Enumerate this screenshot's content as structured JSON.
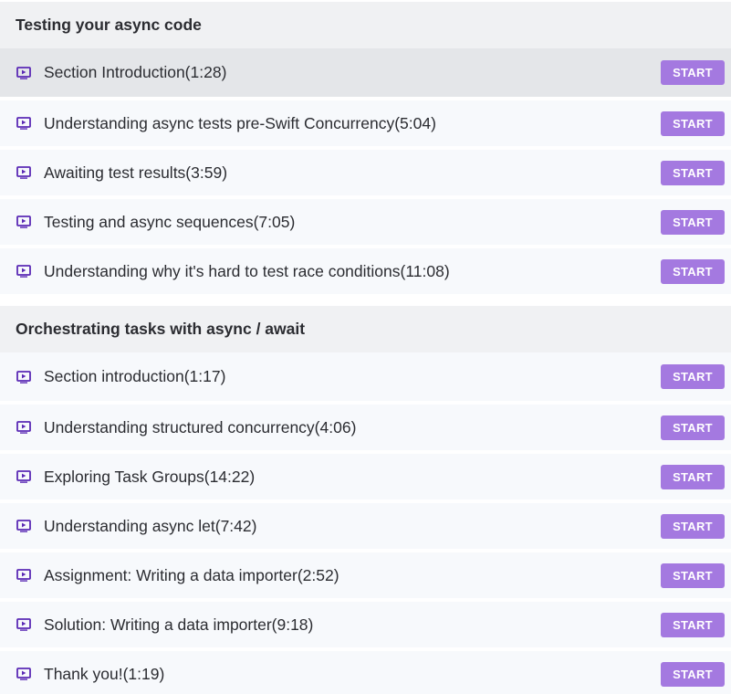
{
  "accent_color": "#a479e0",
  "icon_color": "#5b2ab5",
  "sections": [
    {
      "title": "Testing your async code",
      "lessons": [
        {
          "title": "Section Introduction(1:28)",
          "button": "START",
          "active": true
        },
        {
          "title": "Understanding async tests pre-Swift Concurrency(5:04)",
          "button": "START"
        },
        {
          "title": "Awaiting test results(3:59)",
          "button": "START"
        },
        {
          "title": "Testing and async sequences(7:05)",
          "button": "START"
        },
        {
          "title": "Understanding why it's hard to test race conditions(11:08)",
          "button": "START"
        }
      ]
    },
    {
      "title": "Orchestrating tasks with async / await",
      "lessons": [
        {
          "title": "Section introduction(1:17)",
          "button": "START"
        },
        {
          "title": "Understanding structured concurrency(4:06)",
          "button": "START"
        },
        {
          "title": "Exploring Task Groups(14:22)",
          "button": "START"
        },
        {
          "title": "Understanding async let(7:42)",
          "button": "START"
        },
        {
          "title": "Assignment: Writing a data importer(2:52)",
          "button": "START"
        },
        {
          "title": "Solution: Writing a data importer(9:18)",
          "button": "START"
        },
        {
          "title": "Thank you!(1:19)",
          "button": "START"
        }
      ]
    }
  ]
}
